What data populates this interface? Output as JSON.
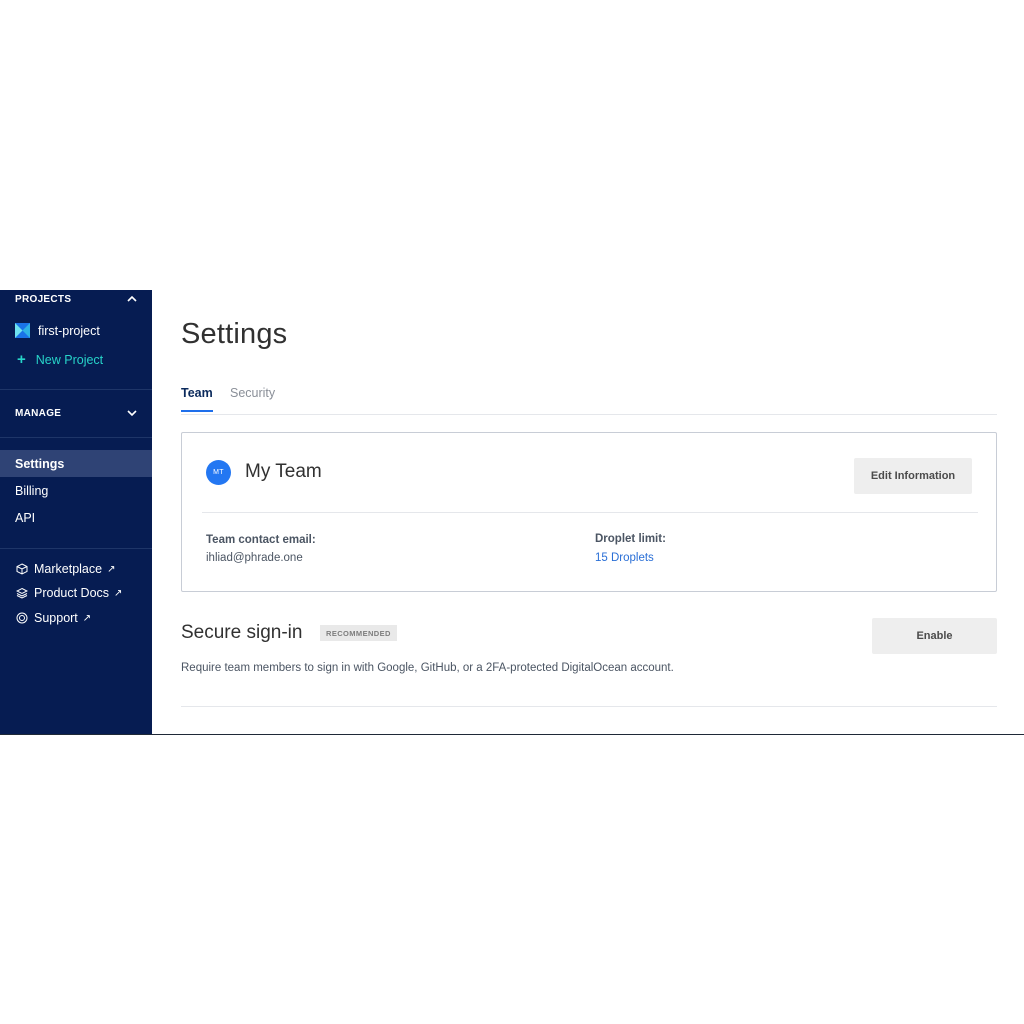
{
  "sidebar": {
    "projects_header": "PROJECTS",
    "project_name": "first-project",
    "new_project_label": "New Project",
    "manage_header": "MANAGE",
    "nav": [
      "Settings",
      "Billing",
      "API"
    ],
    "external": [
      "Marketplace",
      "Product Docs",
      "Support"
    ]
  },
  "main": {
    "title": "Settings",
    "tabs": [
      "Team",
      "Security"
    ],
    "team": {
      "avatar_initials": "MT",
      "name": "My Team",
      "edit_button": "Edit Information",
      "contact_label": "Team contact email:",
      "contact_value": "ihliad@phrade.one",
      "droplet_label": "Droplet limit:",
      "droplet_value": "15 Droplets"
    },
    "secure": {
      "title": "Secure sign-in",
      "badge": "RECOMMENDED",
      "enable_button": "Enable",
      "description": "Require team members to sign in with Google, GitHub, or a 2FA-protected DigitalOcean account."
    }
  },
  "colors": {
    "sidebar_bg": "#061c52",
    "accent_teal": "#27d4c9",
    "link_blue": "#2a6fd6",
    "avatar_blue": "#2377f2"
  }
}
